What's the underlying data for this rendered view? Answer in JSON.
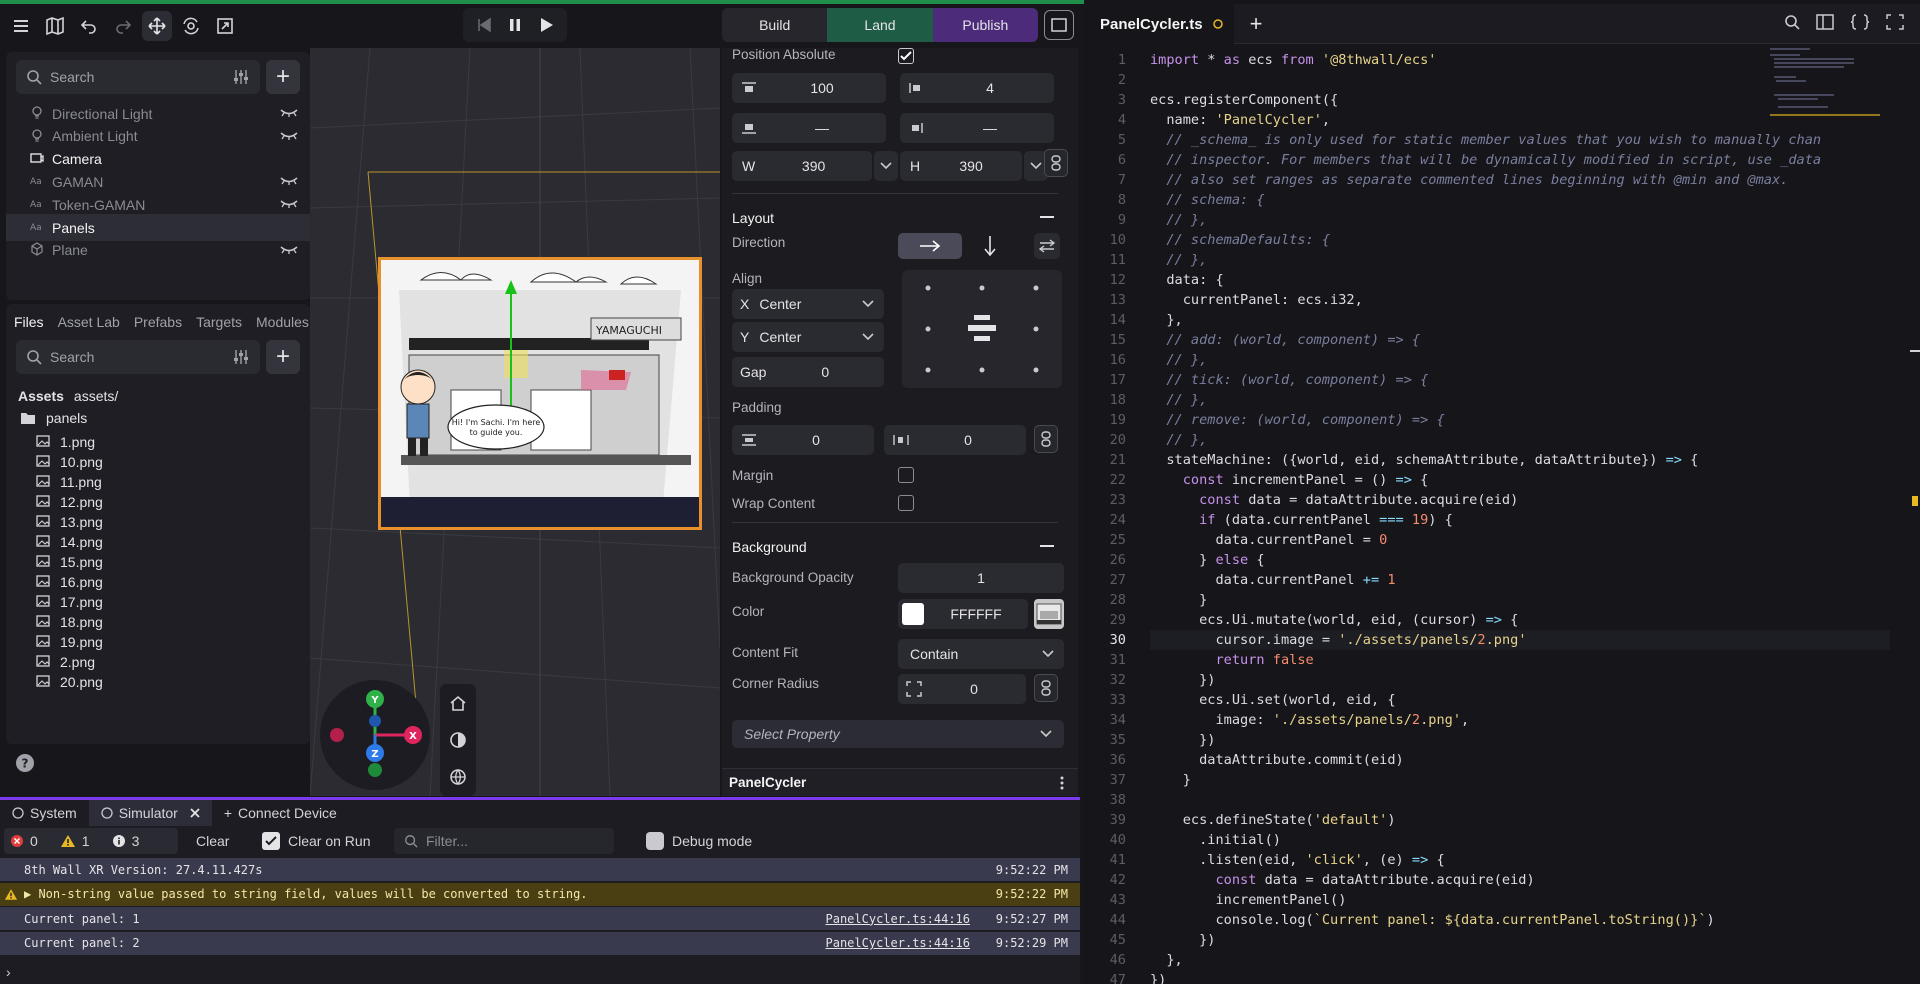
{
  "toolbar": {
    "icons": [
      "menu-icon",
      "map-icon",
      "undo-icon",
      "redo-icon",
      "move-icon",
      "orbit-icon",
      "scale-icon"
    ]
  },
  "top_tabs": {
    "build": "Build",
    "land": "Land",
    "publish": "Publish"
  },
  "hierarchy": {
    "search_placeholder": "Search",
    "items": [
      {
        "label": "Directional Light",
        "icon": "bulb-icon",
        "hidden": true
      },
      {
        "label": "Ambient Light",
        "icon": "bulb-icon",
        "hidden": true
      },
      {
        "label": "Camera",
        "icon": "camera-icon",
        "hidden": false
      },
      {
        "label": "GAMAN",
        "icon": "text-icon",
        "hidden": true
      },
      {
        "label": "Token-GAMAN",
        "icon": "text-icon",
        "hidden": true
      },
      {
        "label": "Panels",
        "icon": "text-icon",
        "hidden": false,
        "selected": true
      },
      {
        "label": "Plane",
        "icon": "cube-icon",
        "hidden": true
      }
    ]
  },
  "files": {
    "tabs": [
      "Files",
      "Asset Lab",
      "Prefabs",
      "Targets",
      "Modules"
    ],
    "search_placeholder": "Search",
    "assets_label": "Assets",
    "assets_path": "assets/",
    "folder": "panels",
    "items": [
      "1.png",
      "10.png",
      "11.png",
      "12.png",
      "13.png",
      "14.png",
      "15.png",
      "16.png",
      "17.png",
      "18.png",
      "19.png",
      "2.png",
      "20.png"
    ]
  },
  "scene": {
    "sign_text": "YAMAGUCHI",
    "bubble_line1": "Hi! I'm Sachi. I'm here",
    "bubble_line2": "to guide you."
  },
  "gizmo": {
    "y": "Y",
    "x": "X",
    "z": "Z"
  },
  "inspector": {
    "position_absolute_label": "Position Absolute",
    "top_value": "100",
    "left_value": "4",
    "bottom_value": "—",
    "right_value": "—",
    "width_label": "W",
    "width_value": "390",
    "height_label": "H",
    "height_value": "390",
    "layout_title": "Layout",
    "direction_label": "Direction",
    "align_label": "Align",
    "align_x_axis": "X",
    "align_x": "Center",
    "align_y_axis": "Y",
    "align_y": "Center",
    "gap_label": "Gap",
    "gap_value": "0",
    "padding_label": "Padding",
    "padding_v": "0",
    "padding_h": "0",
    "margin_label": "Margin",
    "wrap_label": "Wrap Content",
    "background_title": "Background",
    "bg_opacity_label": "Background Opacity",
    "bg_opacity_value": "1",
    "color_label": "Color",
    "color_value": "FFFFFF",
    "content_fit_label": "Content Fit",
    "content_fit_value": "Contain",
    "corner_radius_label": "Corner Radius",
    "corner_radius_value": "0",
    "select_property": "Select Property",
    "component_name": "PanelCycler"
  },
  "console": {
    "tabs": [
      "System",
      "Simulator"
    ],
    "connect_device": "Connect Device",
    "error_count": "0",
    "warning_count": "1",
    "info_count": "3",
    "clear": "Clear",
    "clear_on_run": "Clear on Run",
    "filter_placeholder": "Filter...",
    "debug_mode": "Debug mode",
    "logs": [
      {
        "text": "8th Wall XR Version: 27.4.11.427s",
        "source": "",
        "time": "9:52:22 PM",
        "kind": "normal"
      },
      {
        "text": "▶ Non-string value passed to string field, values will be converted to string.",
        "source": "",
        "time": "9:52:22 PM",
        "kind": "warning"
      },
      {
        "text": "Current panel: 1",
        "source": "PanelCycler.ts:44:16",
        "time": "9:52:27 PM",
        "kind": "normal"
      },
      {
        "text": "Current panel: 2",
        "source": "PanelCycler.ts:44:16",
        "time": "9:52:29 PM",
        "kind": "normal"
      }
    ],
    "prompt": "›"
  },
  "editor": {
    "filename": "PanelCycler.ts",
    "current_line": 30,
    "lines": [
      "import * as ecs from '@8thwall/ecs'",
      "",
      "ecs.registerComponent({",
      "  name: 'PanelCycler',",
      "  // _schema_ is only used for static member values that you wish to manually chan",
      "  // inspector. For members that will be dynamically modified in script, use _data",
      "  // also set ranges as separate commented lines beginning with @min and @max.",
      "  // schema: {",
      "  // },",
      "  // schemaDefaults: {",
      "  // },",
      "  data: {",
      "    currentPanel: ecs.i32,",
      "  },",
      "  // add: (world, component) => {",
      "  // },",
      "  // tick: (world, component) => {",
      "  // },",
      "  // remove: (world, component) => {",
      "  // },",
      "  stateMachine: ({world, eid, schemaAttribute, dataAttribute}) => {",
      "    const incrementPanel = () => {",
      "      const data = dataAttribute.acquire(eid)",
      "      if (data.currentPanel === 19) {",
      "        data.currentPanel = 0",
      "      } else {",
      "        data.currentPanel += 1",
      "      }",
      "      ecs.Ui.mutate(world, eid, (cursor) => {",
      "        cursor.image = './assets/panels/2.png'",
      "        return false",
      "      })",
      "      ecs.Ui.set(world, eid, {",
      "        image: './assets/panels/2.png',",
      "      })",
      "      dataAttribute.commit(eid)",
      "    }",
      "",
      "    ecs.defineState('default')",
      "      .initial()",
      "      .listen(eid, 'click', (e) => {",
      "        const data = dataAttribute.acquire(eid)",
      "        incrementPanel()",
      "        console.log(`Current panel: ${data.currentPanel.toString()}`)",
      "      })",
      "  },",
      "})"
    ]
  },
  "colors": {
    "land": "#1f5c46",
    "publish": "#4c2b7a",
    "accent_green": "#1f8f4a",
    "console_accent": "#7c3aed",
    "selection_orange": "#e8912c"
  }
}
